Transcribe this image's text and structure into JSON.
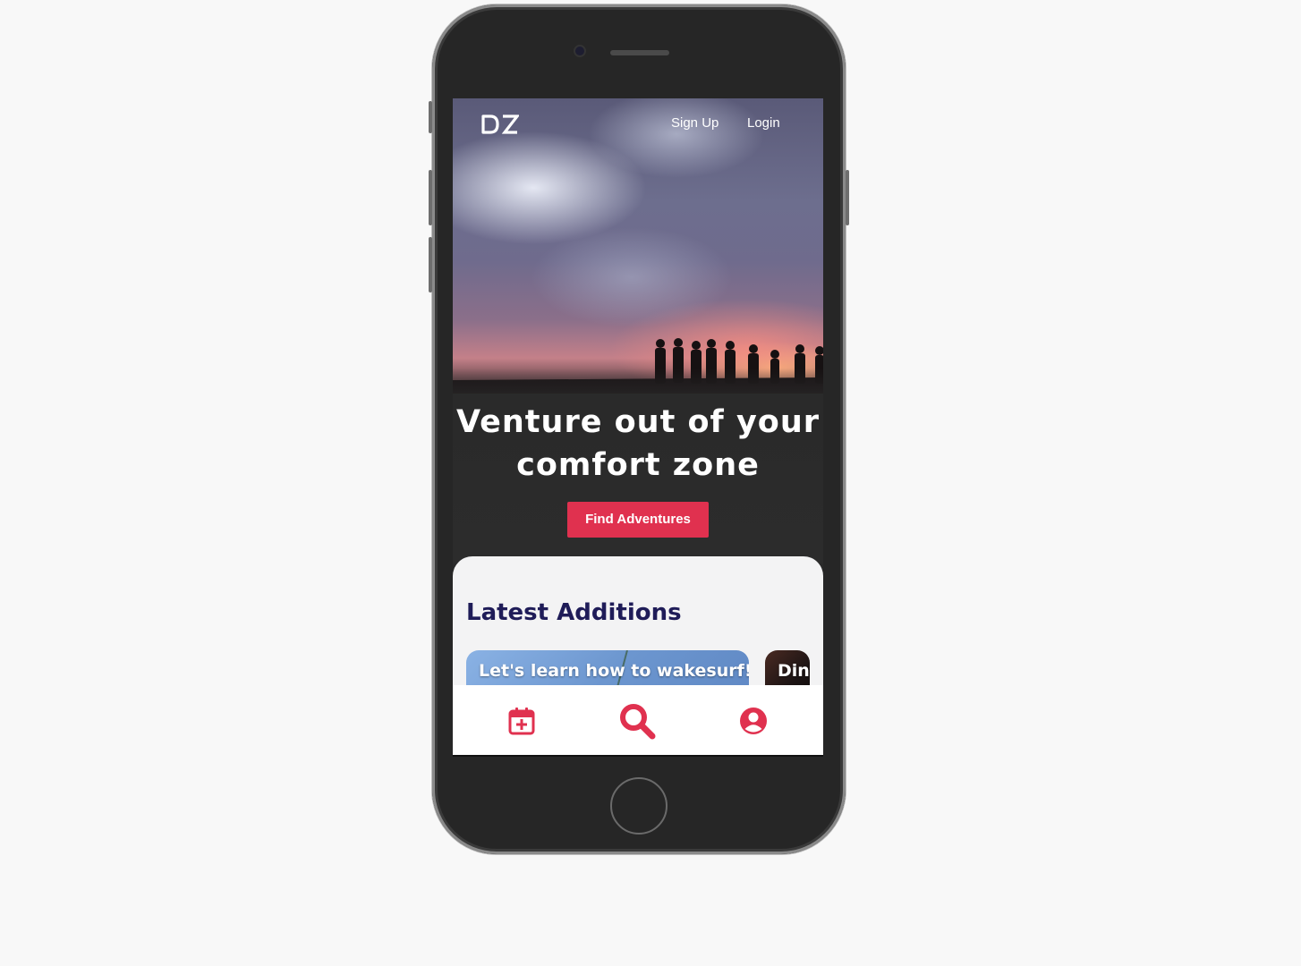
{
  "header": {
    "logo_text": "DZ",
    "signup_label": "Sign Up",
    "login_label": "Login"
  },
  "hero": {
    "headline_line1": "Venture out of your",
    "headline_line2": "comfort zone",
    "cta_label": "Find Adventures"
  },
  "latest": {
    "title": "Latest Additions",
    "cards": [
      {
        "title": "Let's learn how to wakesurf!"
      },
      {
        "title": "Dinr"
      }
    ]
  },
  "tabbar": {
    "items": [
      {
        "icon": "calendar-plus-icon"
      },
      {
        "icon": "search-icon"
      },
      {
        "icon": "user-circle-icon"
      }
    ]
  },
  "colors": {
    "accent": "#e0314f",
    "title": "#1f1c58",
    "panel": "#f3f3f4"
  }
}
